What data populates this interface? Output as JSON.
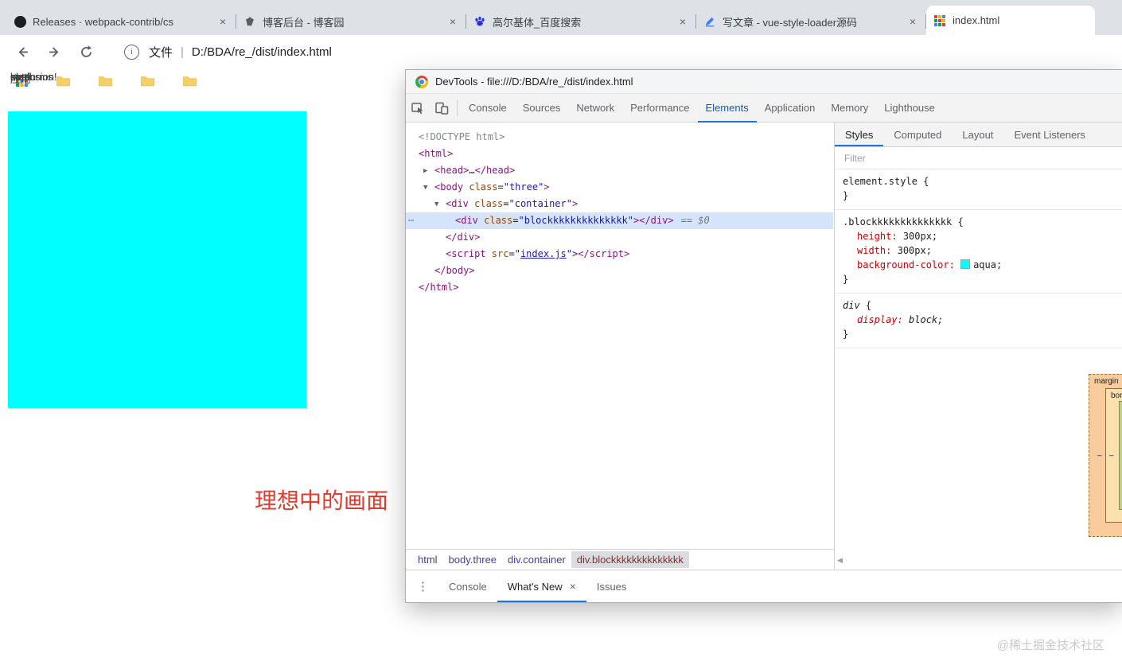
{
  "browser": {
    "close_glyph": "×",
    "tabs": [
      {
        "title": "Releases · webpack-contrib/cs"
      },
      {
        "title": "博客后台 - 博客园"
      },
      {
        "title": "高尔基体_百度搜索"
      },
      {
        "title": "写文章 - vue-style-loader源码"
      },
      {
        "title": "index.html"
      }
    ],
    "address": {
      "scheme_label": "文件",
      "divider": "|",
      "url": "D:/BDA/re_/dist/index.html",
      "info_glyph": "i"
    },
    "bookmarks": {
      "apps_label": "应用",
      "items": [
        "spell",
        "explosion!",
        "koten",
        "platforms"
      ]
    }
  },
  "page": {
    "caption": "理想中的画面",
    "watermark": "@稀土掘金技术社区",
    "aqua_hex": "#00ffff"
  },
  "devtools": {
    "title": "DevTools - file:///D:/BDA/re_/dist/index.html",
    "tabs": [
      "Console",
      "Sources",
      "Network",
      "Performance",
      "Elements",
      "Application",
      "Memory",
      "Lighthouse"
    ],
    "sidebar_tabs": [
      "Styles",
      "Computed",
      "Layout",
      "Event Listeners"
    ],
    "filter_label": "Filter",
    "tree": {
      "gutter_dots": "⋯",
      "arrow_collapsed": "▶",
      "arrow_expanded": "▼",
      "doctype": "<!DOCTYPE html>",
      "html_open": "<html>",
      "head_open": "<head>",
      "head_ellipsis": "…",
      "head_close": "</head>",
      "body_open": "<body",
      "attr_class": " class",
      "eq": "=",
      "body_val": "\"three\"",
      "gt": ">",
      "container_open": "<div",
      "container_val": "\"container\"",
      "block_open": "<div",
      "block_val": "\"blockkkkkkkkkkkkkk\"",
      "block_end": "</div>",
      "selected_hint": "== $0",
      "div_close": "</div>",
      "script_open": "<script",
      "attr_src": " src",
      "quote": "\"",
      "script_src_val": "index.js",
      "quote_gt": "\">",
      "script_close": "</script>",
      "body_close": "</body>",
      "html_close": "</html>"
    },
    "styles": {
      "element_style": {
        "selector": "element.style",
        "open": "{",
        "close": "}"
      },
      "block_rule": {
        "selector": ".blockkkkkkkkkkkkkk",
        "open": "{",
        "close": "}",
        "props": [
          {
            "name": "height:",
            "value": "300px;"
          },
          {
            "name": "width:",
            "value": "300px;"
          },
          {
            "name": "background-color:",
            "value": "aqua;",
            "swatch": "#00ffff"
          }
        ]
      },
      "div_rule": {
        "selector": "div",
        "open": "{",
        "close": "}",
        "props": [
          {
            "name": "display:",
            "value": "block;"
          }
        ]
      }
    },
    "box_model": {
      "margin_label": "margin",
      "border_label": "border",
      "dash": "–"
    },
    "breadcrumbs": [
      {
        "label": "html"
      },
      {
        "label": "body.three"
      },
      {
        "label": "div.container"
      },
      {
        "label": "div.blockkkkkkkkkkkkkk"
      }
    ],
    "drawer": {
      "kebab": "⋮",
      "console": "Console",
      "whats_new": "What's New",
      "close": "×",
      "issues": "Issues"
    },
    "hscroll_left": "◀"
  }
}
